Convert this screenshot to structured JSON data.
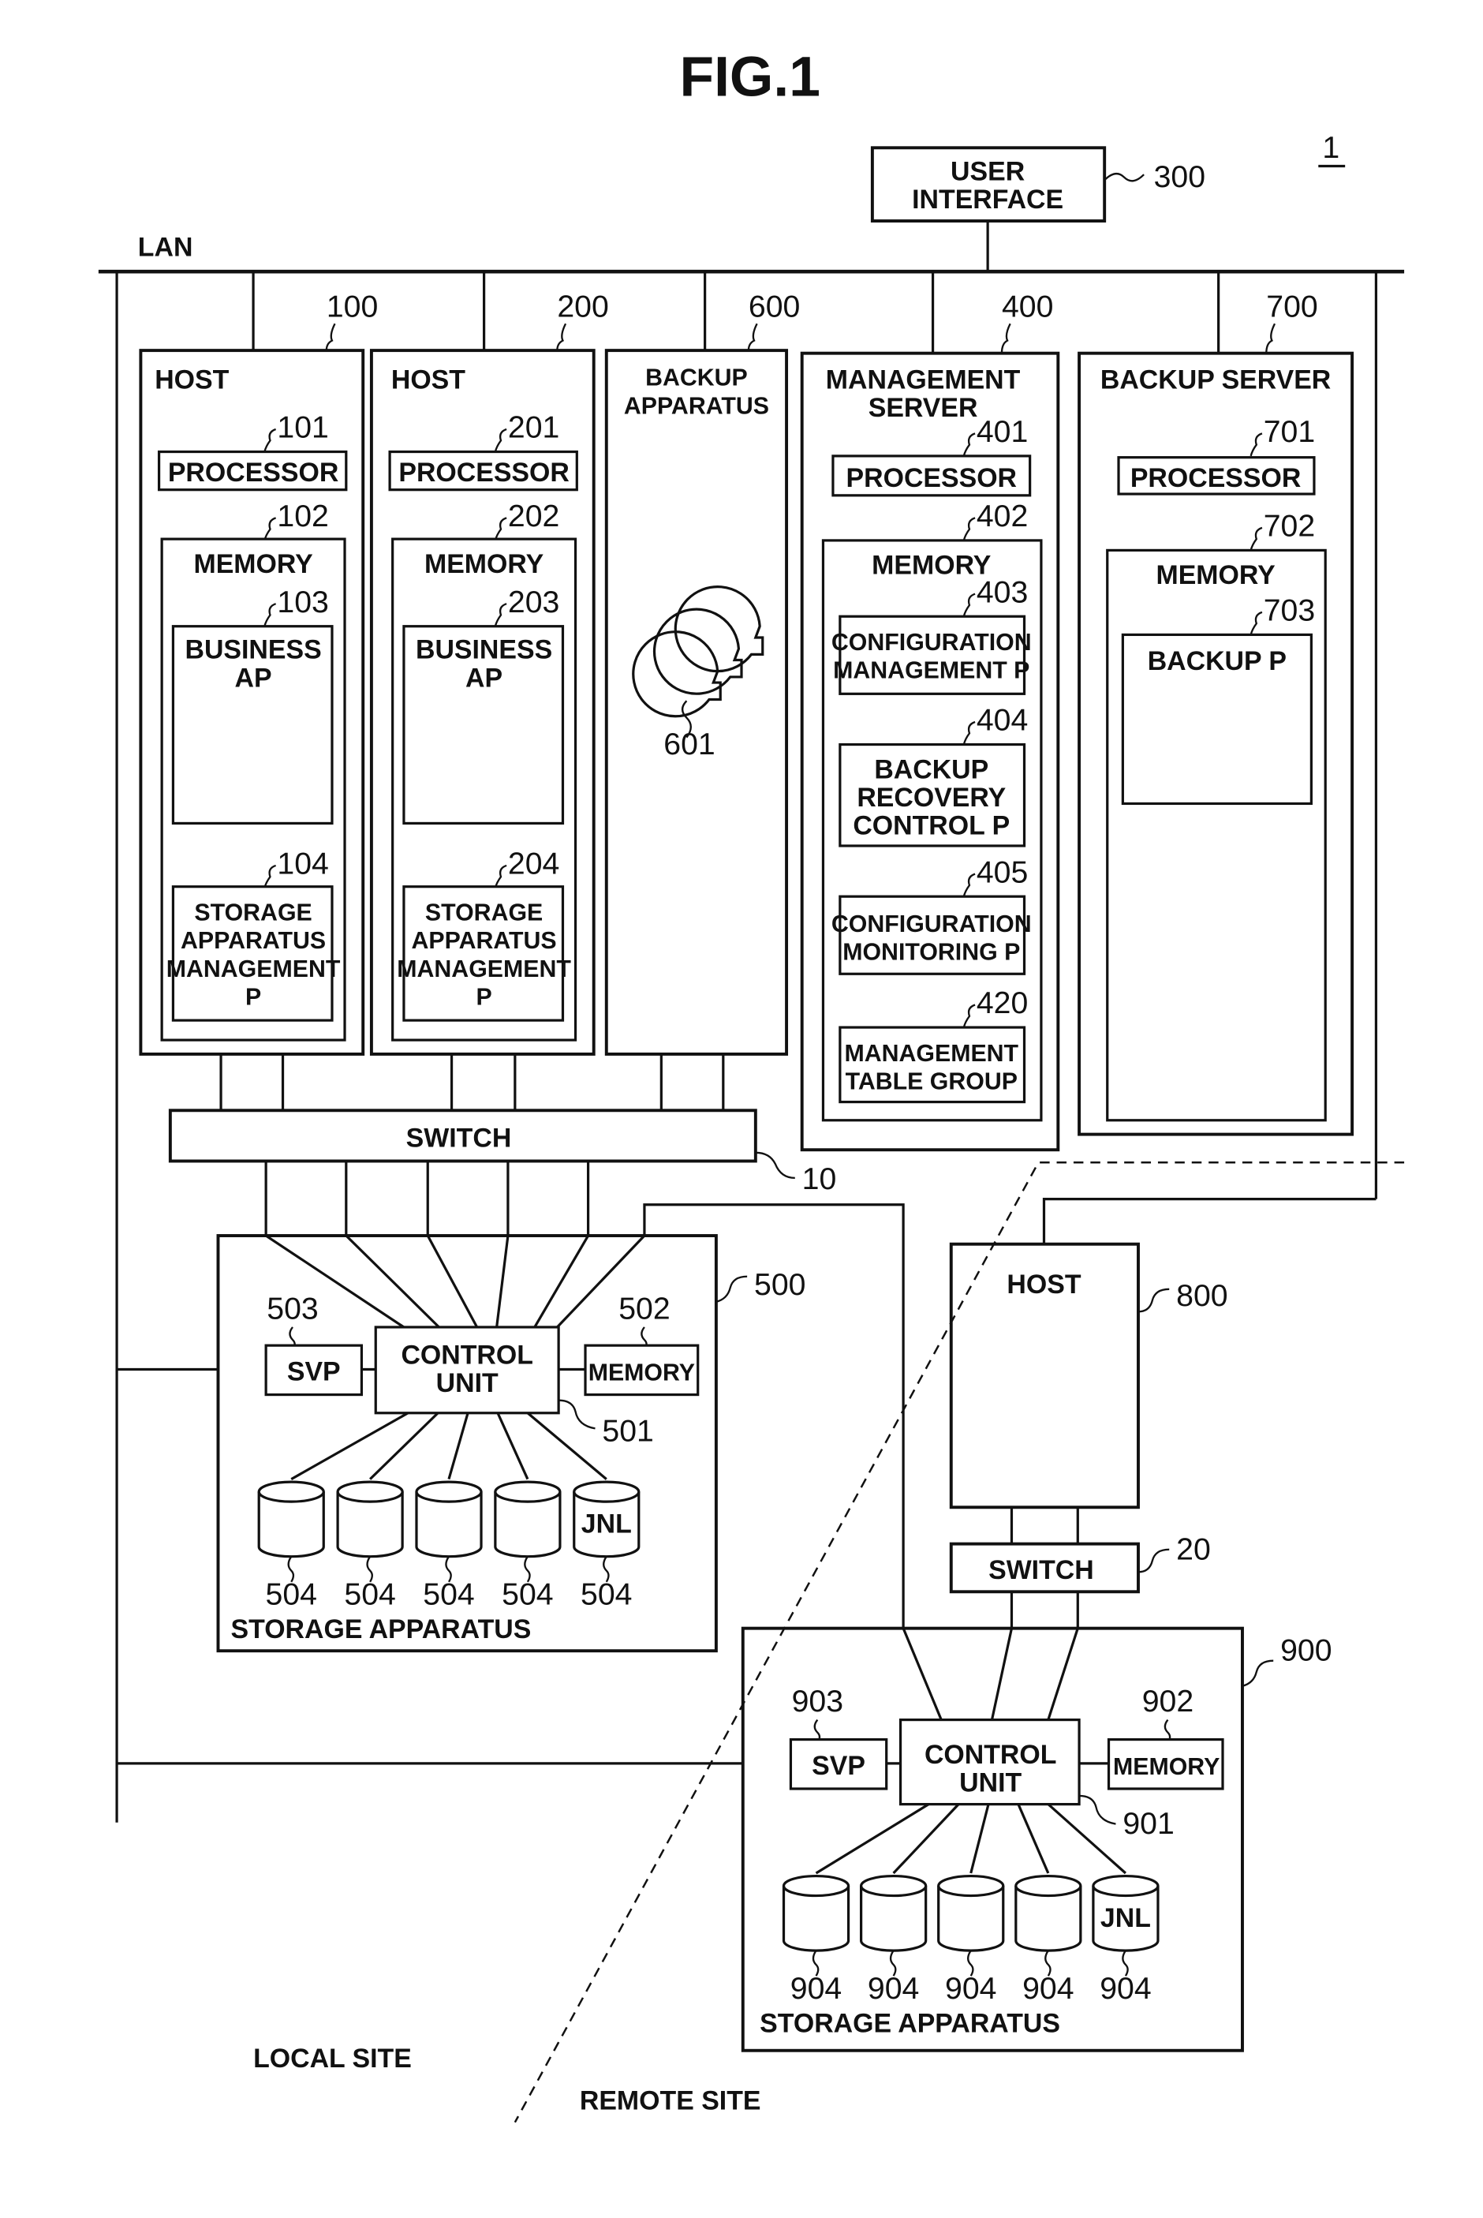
{
  "figure": {
    "title": "FIG.1",
    "system_ref": "1",
    "lan_label": "LAN",
    "local_site_label": "LOCAL SITE",
    "remote_site_label": "REMOTE SITE"
  },
  "user_interface": {
    "label_lines": [
      "USER",
      "INTERFACE"
    ],
    "ref": "300"
  },
  "host_100": {
    "ref": "100",
    "label": "HOST",
    "processor": {
      "label": "PROCESSOR",
      "ref": "101"
    },
    "memory": {
      "label": "MEMORY",
      "ref": "102"
    },
    "business_ap": {
      "label_lines": [
        "BUSINESS",
        "AP"
      ],
      "ref": "103"
    },
    "storage_mgmt": {
      "label_lines": [
        "STORAGE",
        "APPARATUS",
        "MANAGEMENT",
        "P"
      ],
      "ref": "104"
    }
  },
  "host_200": {
    "ref": "200",
    "label": "HOST",
    "processor": {
      "label": "PROCESSOR",
      "ref": "201"
    },
    "memory": {
      "label": "MEMORY",
      "ref": "202"
    },
    "business_ap": {
      "label_lines": [
        "BUSINESS",
        "AP"
      ],
      "ref": "203"
    },
    "storage_mgmt": {
      "label_lines": [
        "STORAGE",
        "APPARATUS",
        "MANAGEMENT",
        "P"
      ],
      "ref": "204"
    }
  },
  "backup_apparatus": {
    "ref": "600",
    "label_lines": [
      "BACKUP",
      "APPARATUS"
    ],
    "media_ref": "601"
  },
  "management_server": {
    "ref": "400",
    "label_lines": [
      "MANAGEMENT",
      "SERVER"
    ],
    "processor": {
      "label": "PROCESSOR",
      "ref": "401"
    },
    "memory": {
      "label": "MEMORY",
      "ref": "402"
    },
    "programs": [
      {
        "ref": "403",
        "label_lines": [
          "CONFIGURATION",
          "MANAGEMENT P"
        ]
      },
      {
        "ref": "404",
        "label_lines": [
          "BACKUP",
          "RECOVERY",
          "CONTROL P"
        ]
      },
      {
        "ref": "405",
        "label_lines": [
          "CONFIGURATION",
          "MONITORING P"
        ]
      },
      {
        "ref": "420",
        "label_lines": [
          "MANAGEMENT",
          "TABLE GROUP"
        ]
      }
    ]
  },
  "backup_server": {
    "ref": "700",
    "label": "BACKUP SERVER",
    "processor": {
      "label": "PROCESSOR",
      "ref": "701"
    },
    "memory": {
      "label": "MEMORY",
      "ref": "702"
    },
    "backup_p": {
      "label": "BACKUP P",
      "ref": "703"
    }
  },
  "switch_10": {
    "label": "SWITCH",
    "ref": "10"
  },
  "storage_500": {
    "ref": "500",
    "label": "STORAGE APPARATUS",
    "control_unit": {
      "label_lines": [
        "CONTROL",
        "UNIT"
      ],
      "ref": "501"
    },
    "memory": {
      "label": "MEMORY",
      "ref": "502"
    },
    "svp": {
      "label": "SVP",
      "ref": "503"
    },
    "volumes": [
      {
        "ref": "504",
        "label": ""
      },
      {
        "ref": "504",
        "label": ""
      },
      {
        "ref": "504",
        "label": ""
      },
      {
        "ref": "504",
        "label": ""
      },
      {
        "ref": "504",
        "label": "JNL"
      }
    ]
  },
  "host_800": {
    "label": "HOST",
    "ref": "800"
  },
  "switch_20": {
    "label": "SWITCH",
    "ref": "20"
  },
  "storage_900": {
    "ref": "900",
    "label": "STORAGE APPARATUS",
    "control_unit": {
      "label_lines": [
        "CONTROL",
        "UNIT"
      ],
      "ref": "901"
    },
    "memory": {
      "label": "MEMORY",
      "ref": "902"
    },
    "svp": {
      "label": "SVP",
      "ref": "903"
    },
    "volumes": [
      {
        "ref": "904",
        "label": ""
      },
      {
        "ref": "904",
        "label": ""
      },
      {
        "ref": "904",
        "label": ""
      },
      {
        "ref": "904",
        "label": ""
      },
      {
        "ref": "904",
        "label": "JNL"
      }
    ]
  }
}
